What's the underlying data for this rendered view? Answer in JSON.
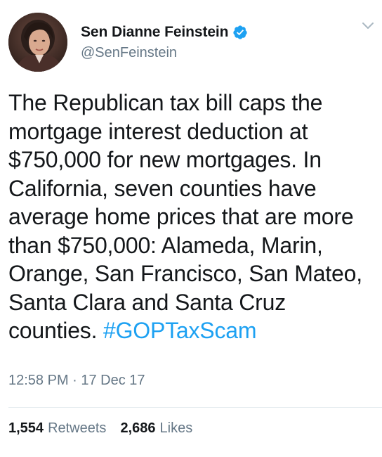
{
  "author": {
    "display_name": "Sen Dianne Feinstein",
    "handle": "@SenFeinstein",
    "verified": true,
    "avatar_icon": "profile-photo"
  },
  "tweet": {
    "body": "The Republican tax bill caps the mortgage interest deduction at $750,000 for new mortgages. In California, seven counties have average home prices that are more than $750,000: Alameda, Marin, Orange, San Francisco, San Mateo, Santa Clara and Santa Cruz counties.",
    "hashtag": "#GOPTaxScam",
    "timestamp": "12:58 PM · 17 Dec 17"
  },
  "stats": {
    "retweets_count": "1,554",
    "retweets_label": "Retweets",
    "likes_count": "2,686",
    "likes_label": "Likes"
  },
  "icons": {
    "verified": "verified-badge-icon",
    "menu": "chevron-down-icon"
  },
  "colors": {
    "accent": "#1da1f2",
    "text_primary": "#14171a",
    "text_secondary": "#657786",
    "divider": "#e6ecf0"
  }
}
